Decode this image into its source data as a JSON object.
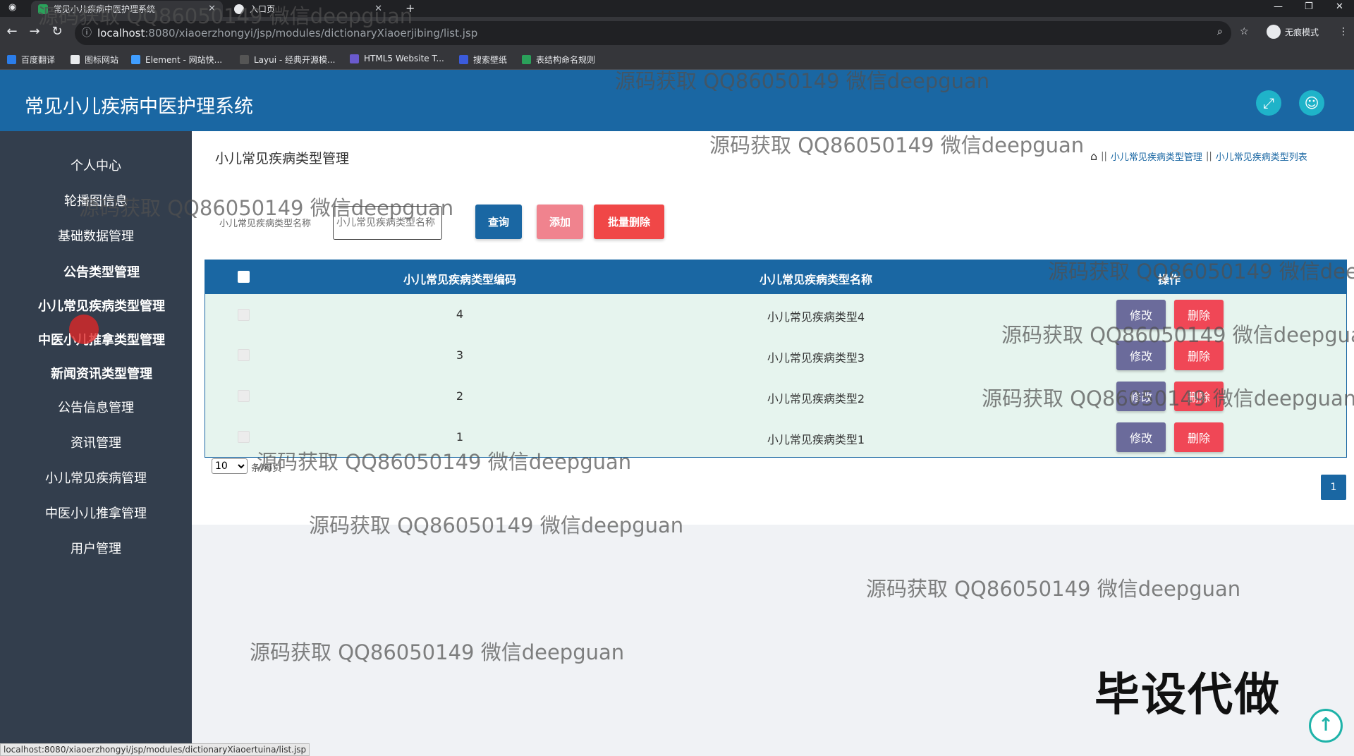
{
  "browser": {
    "tabs": [
      {
        "title": "常见小儿疾病中医护理系统"
      },
      {
        "title": "入口页"
      }
    ],
    "url_host": "localhost",
    "url_path": ":8080/xiaoerzhongyi/jsp/modules/dictionaryXiaoerjibing/list.jsp",
    "incognito": "无痕模式",
    "bookmarks": [
      "百度翻译",
      "图标网站",
      "Element - 网站快...",
      "Layui - 经典开源模...",
      "HTML5 Website T...",
      "搜索壁纸",
      "表结构命名规则"
    ],
    "status_url": "localhost:8080/xiaoerzhongyi/jsp/modules/dictionaryXiaoertuina/list.jsp"
  },
  "header": {
    "title": "常见小儿疾病中医护理系统"
  },
  "sidebar": {
    "items": [
      {
        "label": "个人中心"
      },
      {
        "label": "轮播图信息"
      },
      {
        "label": "基础数据管理"
      },
      {
        "label": "公告类型管理"
      },
      {
        "label": "小儿常见疾病类型管理"
      },
      {
        "label": "中医小儿推拿类型管理"
      },
      {
        "label": "新闻资讯类型管理"
      },
      {
        "label": "公告信息管理"
      },
      {
        "label": "资讯管理"
      },
      {
        "label": "小儿常见疾病管理"
      },
      {
        "label": "中医小儿推拿管理"
      },
      {
        "label": "用户管理"
      }
    ]
  },
  "page": {
    "title": "小儿常见疾病类型管理",
    "breadcrumb": [
      "小儿常见疾病类型管理",
      "小儿常见疾病类型列表"
    ]
  },
  "search": {
    "label": "小儿常见疾病类型名称",
    "placeholder": "小儿常见疾病类型名称",
    "query_label": "查询",
    "add_label": "添加",
    "batch_delete_label": "批量删除"
  },
  "table": {
    "columns": [
      "小儿常见疾病类型编码",
      "小儿常见疾病类型名称",
      "操作"
    ],
    "rows": [
      {
        "code": "4",
        "name": "小儿常见疾病类型4"
      },
      {
        "code": "3",
        "name": "小儿常见疾病类型3"
      },
      {
        "code": "2",
        "name": "小儿常见疾病类型2"
      },
      {
        "code": "1",
        "name": "小儿常见疾病类型1"
      }
    ],
    "edit_label": "修改",
    "delete_label": "删除"
  },
  "pagination": {
    "page_size": "10",
    "page_size_suffix": "条/每页",
    "current_page": "1"
  },
  "watermark": {
    "text": "源码获取 QQ86050149 微信deepguan",
    "stamp": "毕设代做"
  },
  "colors": {
    "header": "#1a67a3",
    "sidebar": "#333e4d",
    "table_row": "#e6f4ee",
    "danger": "#f04756",
    "edit": "#6b6b9b"
  }
}
